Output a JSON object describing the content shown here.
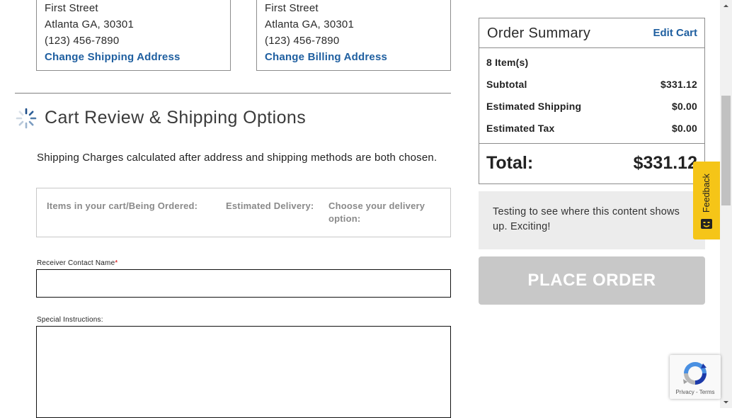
{
  "shipping_address": {
    "street": "First Street",
    "city_line": "Atlanta GA, 30301",
    "phone": "(123) 456-7890",
    "change_link": "Change Shipping Address"
  },
  "billing_address": {
    "street": "First Street",
    "city_line": "Atlanta GA, 30301",
    "phone": "(123) 456-7890",
    "change_link": "Change Billing Address"
  },
  "cart_review": {
    "title": "Cart Review & Shipping Options",
    "note": "Shipping Charges calculated after address and shipping methods are both chosen.",
    "columns": [
      "Items in your cart/Being Ordered:",
      "Estimated Delivery:",
      "Choose your delivery option:"
    ]
  },
  "form": {
    "receiver_label": "Receiver Contact Name",
    "receiver_required": "*",
    "receiver_value": "",
    "instructions_label": "Special Instructions:",
    "instructions_value": ""
  },
  "order_summary": {
    "title": "Order Summary",
    "edit_link": "Edit Cart",
    "items_count": "8 Item(s)",
    "rows": [
      {
        "label": "Subtotal",
        "value": "$331.12"
      },
      {
        "label": "Estimated Shipping",
        "value": "$0.00"
      },
      {
        "label": "Estimated Tax",
        "value": "$0.00"
      }
    ],
    "total_label": "Total:",
    "total_value": "$331.12"
  },
  "promo_text": "Testing to see where this content shows up. Exciting!",
  "place_order_label": "PLACE ORDER",
  "feedback_label": "Feedback",
  "recaptcha": {
    "privacy": "Privacy",
    "separator": " - ",
    "terms": "Terms"
  },
  "colors": {
    "link": "#1f5fa0",
    "button_disabled": "#c8c8c8",
    "feedback_tab": "#f5c518",
    "promo_bg": "#ececec"
  },
  "icons": {
    "loading": "loading-spinner-icon",
    "feedback": "feedback-face-icon",
    "recaptcha": "recaptcha-logo-icon"
  }
}
